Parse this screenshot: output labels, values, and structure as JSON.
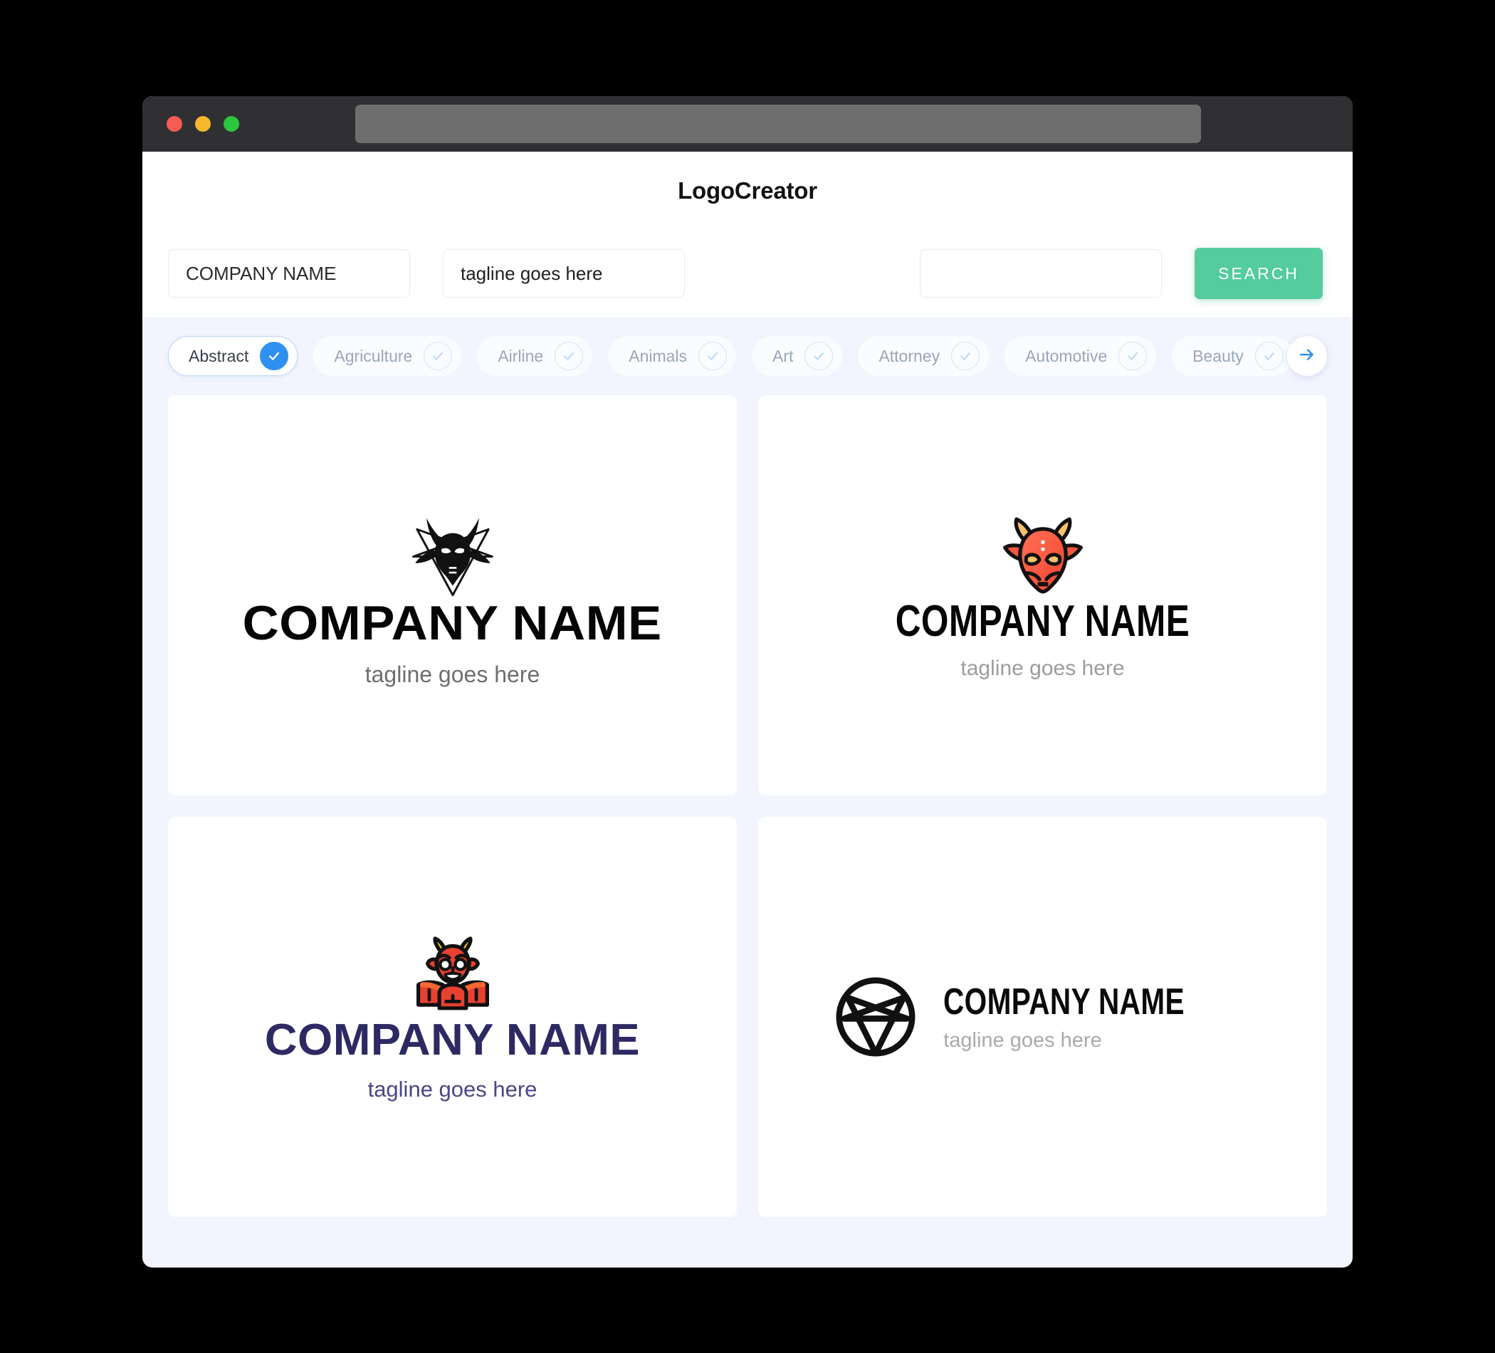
{
  "window": {
    "traffic_lights": [
      "close",
      "minimize",
      "maximize"
    ],
    "url_value": ""
  },
  "header": {
    "app_title": "LogoCreator"
  },
  "search": {
    "company_value": "COMPANY NAME",
    "company_placeholder": "COMPANY NAME",
    "tagline_value": "tagline goes here",
    "tagline_placeholder": "tagline goes here",
    "keyword_value": "",
    "keyword_placeholder": "",
    "search_label": "SEARCH",
    "search_color": "#55CC9D"
  },
  "categories": {
    "accent_color": "#2F90F2",
    "next_icon": "arrow-right-icon",
    "items": [
      {
        "label": "Abstract",
        "selected": true
      },
      {
        "label": "Agriculture",
        "selected": false
      },
      {
        "label": "Airline",
        "selected": false
      },
      {
        "label": "Animals",
        "selected": false
      },
      {
        "label": "Art",
        "selected": false
      },
      {
        "label": "Attorney",
        "selected": false
      },
      {
        "label": "Automotive",
        "selected": false
      },
      {
        "label": "Beauty",
        "selected": false
      }
    ]
  },
  "results": [
    {
      "mark": "baphomet-pentagram-icon",
      "company": "COMPANY NAME",
      "tagline": "tagline goes here",
      "name_color": "#050505",
      "tagline_color": "#6E6E6E",
      "layout": "stacked"
    },
    {
      "mark": "devil-head-icon",
      "company": "COMPANY NAME",
      "tagline": "tagline goes here",
      "name_color": "#050505",
      "tagline_color": "#9C9C9C",
      "layout": "stacked"
    },
    {
      "mark": "winged-devil-icon",
      "company": "COMPANY NAME",
      "tagline": "tagline goes here",
      "name_color": "#2D2A63",
      "tagline_color": "#4A4785",
      "layout": "stacked"
    },
    {
      "mark": "pentagram-circle-icon",
      "company": "COMPANY NAME",
      "tagline": "tagline goes here",
      "name_color": "#0A0A0A",
      "tagline_color": "#AAAAAA",
      "layout": "horizontal"
    }
  ]
}
